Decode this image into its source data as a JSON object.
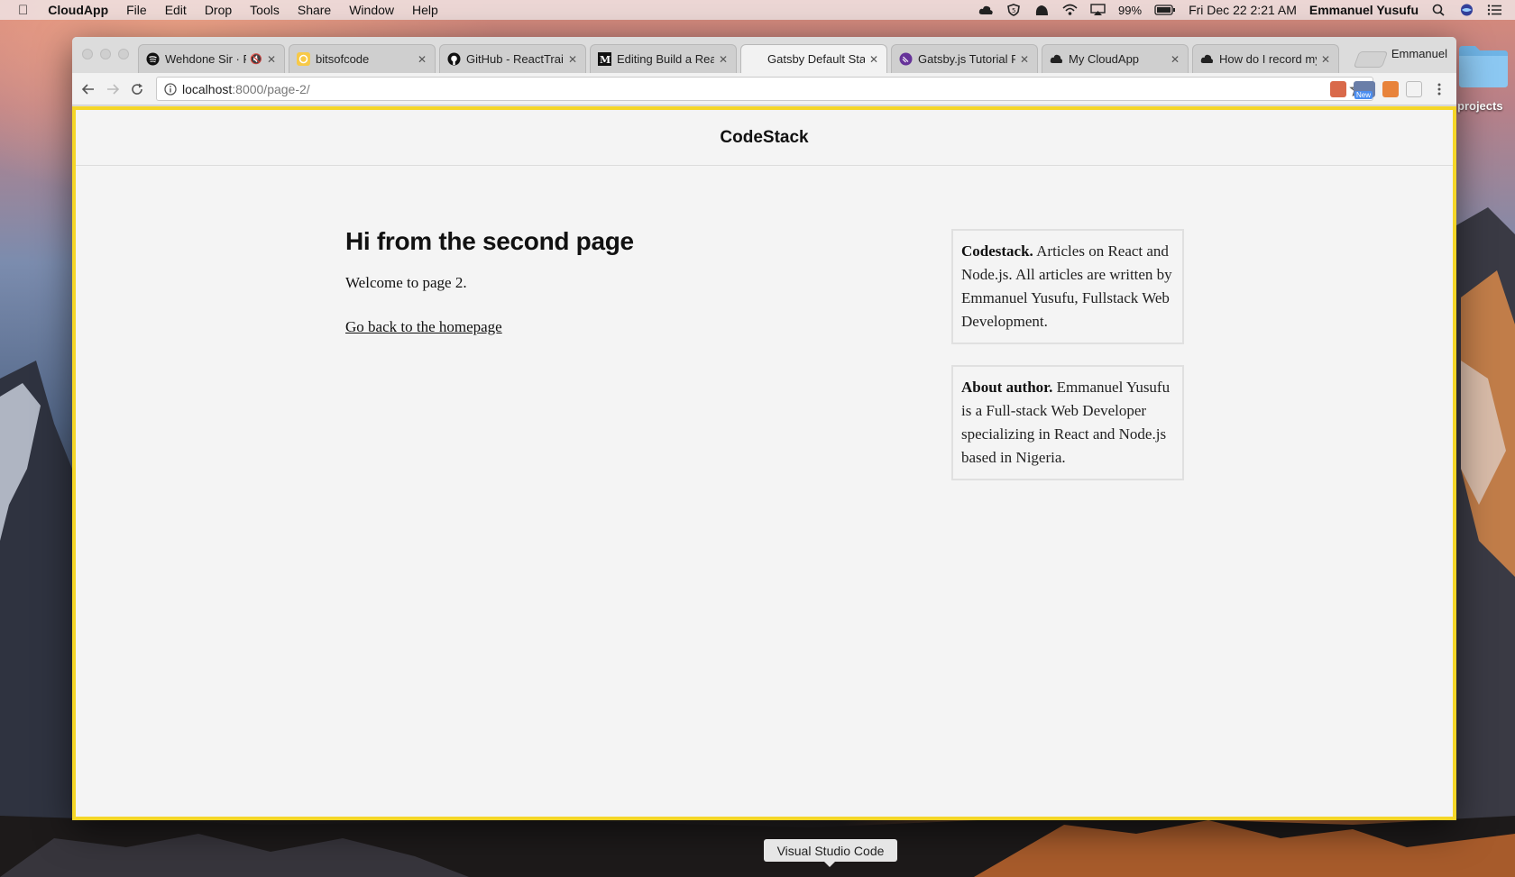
{
  "menubar": {
    "app_name": "CloudApp",
    "menus": [
      "File",
      "Edit",
      "Drop",
      "Tools",
      "Share",
      "Window",
      "Help"
    ],
    "battery": "99%",
    "datetime": "Fri Dec 22  2:21 AM",
    "user": "Emmanuel Yusufu"
  },
  "browser": {
    "tabs": [
      {
        "title": "Wehdone Sir · Fa",
        "icon": "spotify-icon",
        "muted": true
      },
      {
        "title": "bitsofcode",
        "icon": "bitsofcode-icon"
      },
      {
        "title": "GitHub - ReactTrain",
        "icon": "github-icon"
      },
      {
        "title": "Editing Build a Reac",
        "icon": "medium-icon"
      },
      {
        "title": "Gatsby Default Star",
        "icon": "none",
        "active": true
      },
      {
        "title": "Gatsby.js Tutorial P",
        "icon": "gatsby-icon"
      },
      {
        "title": "My CloudApp",
        "icon": "cloudapp-icon"
      },
      {
        "title": "How do I record my",
        "icon": "cloudapp-icon"
      }
    ],
    "profile_name": "Emmanuel",
    "url_host": "localhost",
    "url_rest": ":8000/page-2/",
    "extension_badge": "New"
  },
  "page": {
    "site_title": "CodeStack",
    "heading": "Hi from the second page",
    "intro": "Welcome to page 2.",
    "back_link": "Go back to the homepage",
    "boxes": [
      {
        "title": "Codestack.",
        "text": " Articles on React and Node.js. All articles are written by Emmanuel Yusufu, Fullstack Web Development."
      },
      {
        "title": "About author.",
        "text": " Emmanuel Yusufu is a Full-stack Web Developer specializing in React and Node.js based in Nigeria."
      }
    ]
  },
  "desktop": {
    "folder_label": "projects",
    "dock_tooltip": "Visual Studio Code"
  },
  "colors": {
    "viewport_border": "#f5d627",
    "page_background": "#f4f4f4"
  }
}
